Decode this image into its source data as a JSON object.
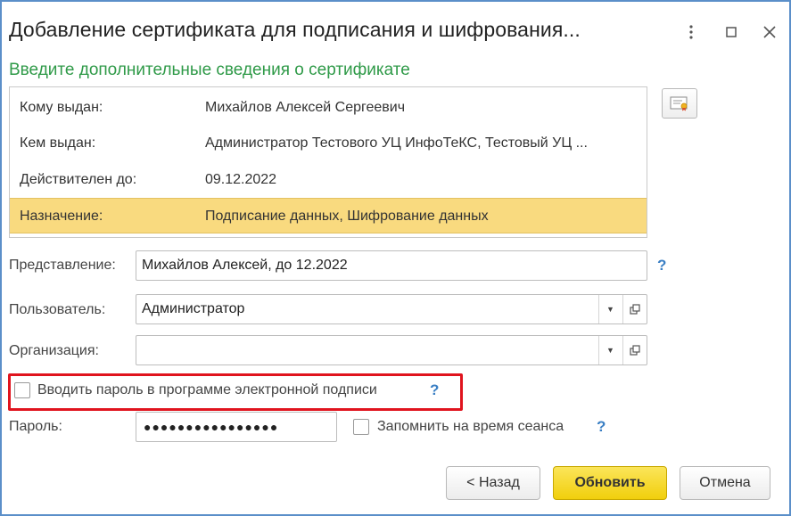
{
  "window": {
    "title": "Добавление сертификата для подписания и шифрования...",
    "more_icon": "more-vertical-icon",
    "maximize_icon": "maximize-icon",
    "close_icon": "close-icon"
  },
  "subtitle": "Введите дополнительные сведения о сертификате",
  "certificate_info": [
    {
      "label": "Кому выдан:",
      "value": "Михайлов Алексей Сергеевич",
      "selected": false
    },
    {
      "label": "Кем выдан:",
      "value": "Администратор Тестового УЦ ИнфоТеКС, Тестовый УЦ ...",
      "selected": false
    },
    {
      "label": "Действителен до:",
      "value": "09.12.2022",
      "selected": false
    },
    {
      "label": "Назначение:",
      "value": "Подписание данных, Шифрование данных",
      "selected": true
    }
  ],
  "certificate_button_icon": "certificate-icon",
  "form": {
    "representation": {
      "label": "Представление:",
      "value": "Михайлов Алексей, до 12.2022",
      "help": "?"
    },
    "user": {
      "label": "Пользователь:",
      "value": "Администратор"
    },
    "organization": {
      "label": "Организация:",
      "value": ""
    },
    "enter_password_in_app": {
      "label": "Вводить пароль в программе электронной подписи",
      "checked": false,
      "help": "?"
    },
    "password": {
      "label": "Пароль:",
      "value": "●●●●●●●●●●●●●●●●"
    },
    "remember_session": {
      "label": "Запомнить на время сеанса",
      "checked": false,
      "help": "?"
    }
  },
  "buttons": {
    "back": "< Назад",
    "update": "Обновить",
    "cancel": "Отмена"
  },
  "colors": {
    "accent_green": "#2f9a48",
    "selected_row": "#f9da7f",
    "primary_button": "#f1cf0c",
    "highlight_frame": "#e0141e",
    "help": "#3a7fc4"
  }
}
